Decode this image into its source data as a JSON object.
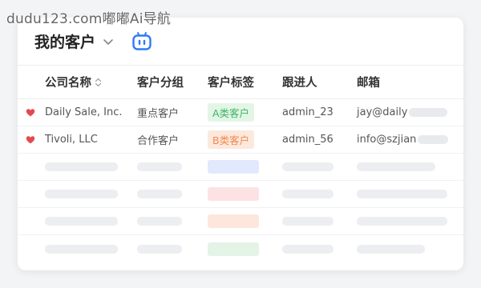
{
  "watermark": "dudu123.com嘟嘟Ai导航",
  "header": {
    "title": "我的客户",
    "accent": "#2f7bf6"
  },
  "table": {
    "columns": [
      "公司名称",
      "客户分组",
      "客户标签",
      "跟进人",
      "邮箱"
    ],
    "rows": [
      {
        "company": "Daily Sale, Inc.",
        "group": "重点客户",
        "tag": "A类客户",
        "owner": "admin_23",
        "email": "jay@daily"
      },
      {
        "company": "Tivoli, LLC",
        "group": "合作客户",
        "tag": "B类客户",
        "owner": "admin_56",
        "email": "info@szjian"
      }
    ],
    "skeleton_tag_colors": [
      "#e3e9fd",
      "#fde2e4",
      "#fde6dc",
      "#e3f4e6"
    ]
  },
  "colors": {
    "heart": "#e34a4f",
    "tag_a_bg": "#e3f6e6",
    "tag_a_text": "#3fb468",
    "tag_b_bg": "#fde8dc",
    "tag_b_text": "#ef8a4e"
  }
}
